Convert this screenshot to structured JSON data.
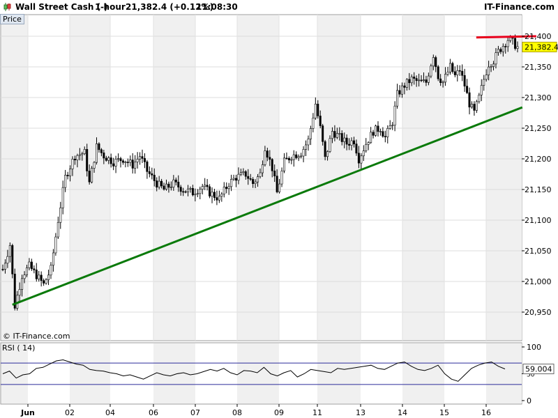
{
  "header": {
    "instrument": "Wall Street Cash (-)",
    "timeframe": "1 hour",
    "quote": "21,382.4 (+0.12%)",
    "time": "11:08:30",
    "brand": "IT-Finance.com"
  },
  "price_panel_label": "Price",
  "watermark": "© IT-Finance.com",
  "current_price_label": "21,382.4",
  "rsi": {
    "label": "RSI ( 14)",
    "value_label": "59.004",
    "ticks": [
      "100",
      "50",
      "0"
    ]
  },
  "colors": {
    "up_candle": "#ffffff",
    "down_candle": "#000000",
    "trendline": "#0a7a0a",
    "resistance": "#e8001c",
    "price_badge": "#ffff00",
    "rsi_band": "#2a2a9a"
  },
  "chart_data": [
    {
      "type": "candlestick",
      "title": "Wall Street Cash (-)",
      "ylim": [
        20920,
        21420
      ],
      "y_ticks": [
        "21,400",
        "21,350",
        "21,300",
        "21,250",
        "21,200",
        "21,150",
        "21,100",
        "21,050",
        "21,000",
        "20,950"
      ],
      "x_ticks": [
        "Jun",
        "02",
        "04",
        "06",
        "07",
        "08",
        "09",
        "11",
        "13",
        "14",
        "15",
        "16"
      ],
      "grid": true,
      "shaded_day_bands": true,
      "close_path": [
        [
          0,
          21020
        ],
        [
          3,
          21060
        ],
        [
          5,
          20960
        ],
        [
          8,
          21010
        ],
        [
          11,
          21025
        ],
        [
          14,
          21010
        ],
        [
          17,
          20995
        ],
        [
          20,
          21020
        ],
        [
          23,
          21100
        ],
        [
          26,
          21170
        ],
        [
          30,
          21205
        ],
        [
          34,
          21210
        ],
        [
          36,
          21160
        ],
        [
          39,
          21220
        ],
        [
          42,
          21205
        ],
        [
          46,
          21195
        ],
        [
          50,
          21200
        ],
        [
          54,
          21190
        ],
        [
          57,
          21205
        ],
        [
          60,
          21180
        ],
        [
          64,
          21160
        ],
        [
          67,
          21150
        ],
        [
          71,
          21160
        ],
        [
          75,
          21150
        ],
        [
          79,
          21145
        ],
        [
          83,
          21155
        ],
        [
          86,
          21145
        ],
        [
          90,
          21135
        ],
        [
          94,
          21160
        ],
        [
          97,
          21170
        ],
        [
          101,
          21175
        ],
        [
          104,
          21160
        ],
        [
          107,
          21175
        ],
        [
          109,
          21220
        ],
        [
          112,
          21185
        ],
        [
          114,
          21145
        ],
        [
          117,
          21195
        ],
        [
          120,
          21205
        ],
        [
          124,
          21210
        ],
        [
          127,
          21230
        ],
        [
          130,
          21290
        ],
        [
          132,
          21250
        ],
        [
          134,
          21200
        ],
        [
          137,
          21245
        ],
        [
          140,
          21235
        ],
        [
          143,
          21225
        ],
        [
          146,
          21230
        ],
        [
          148,
          21200
        ],
        [
          151,
          21225
        ],
        [
          154,
          21245
        ],
        [
          157,
          21250
        ],
        [
          159,
          21235
        ],
        [
          162,
          21260
        ],
        [
          164,
          21305
        ],
        [
          167,
          21320
        ],
        [
          170,
          21330
        ],
        [
          173,
          21325
        ],
        [
          176,
          21325
        ],
        [
          179,
          21370
        ],
        [
          181,
          21335
        ],
        [
          183,
          21325
        ],
        [
          186,
          21350
        ],
        [
          188,
          21335
        ],
        [
          190,
          21345
        ],
        [
          192,
          21320
        ],
        [
          194,
          21290
        ],
        [
          196,
          21275
        ],
        [
          198,
          21300
        ],
        [
          200,
          21330
        ],
        [
          202,
          21355
        ],
        [
          204,
          21360
        ],
        [
          206,
          21375
        ],
        [
          208,
          21385
        ],
        [
          210,
          21395
        ],
        [
          212,
          21390
        ],
        [
          214,
          21382
        ]
      ],
      "trendline": [
        [
          4,
          20962
        ],
        [
          216,
          21284
        ]
      ],
      "resistance_line": [
        [
          198,
          21398
        ],
        [
          216,
          21400
        ]
      ]
    },
    {
      "type": "line",
      "title": "RSI ( 14)",
      "ylim": [
        0,
        100
      ],
      "bands": [
        30,
        70
      ],
      "values": [
        50,
        55,
        42,
        48,
        50,
        60,
        62,
        68,
        74,
        76,
        72,
        68,
        66,
        58,
        56,
        55,
        52,
        50,
        46,
        48,
        44,
        40,
        46,
        52,
        48,
        46,
        50,
        52,
        48,
        50,
        54,
        58,
        55,
        60,
        52,
        48,
        56,
        55,
        52,
        62,
        50,
        46,
        52,
        56,
        44,
        50,
        58,
        56,
        54,
        52,
        60,
        58,
        60,
        62,
        64,
        66,
        60,
        58,
        64,
        70,
        72,
        64,
        58,
        56,
        60,
        66,
        50,
        40,
        36,
        48,
        60,
        66,
        70,
        72,
        64,
        59
      ]
    }
  ]
}
